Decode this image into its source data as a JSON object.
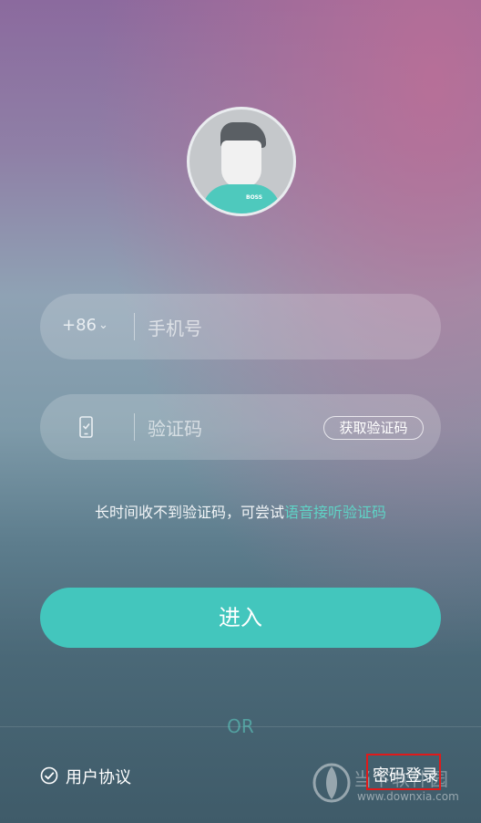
{
  "logo": {
    "brand": "BOSS"
  },
  "phone_field": {
    "country_code": "+86",
    "placeholder": "手机号"
  },
  "code_field": {
    "placeholder": "验证码",
    "get_code_button": "获取验证码"
  },
  "hint": {
    "text": "长时间收不到验证码，可尝试",
    "link": "语音接听验证码"
  },
  "enter_button": "进入",
  "or_text": "OR",
  "agreement": {
    "label": "用户协议",
    "checked": true
  },
  "password_login": "密码登录",
  "watermark": {
    "text": "当下软件园",
    "url": "www.downxia.com"
  },
  "colors": {
    "accent": "#43c6bd",
    "link": "#5fd3c6",
    "highlight_box": "#e01a1a"
  }
}
